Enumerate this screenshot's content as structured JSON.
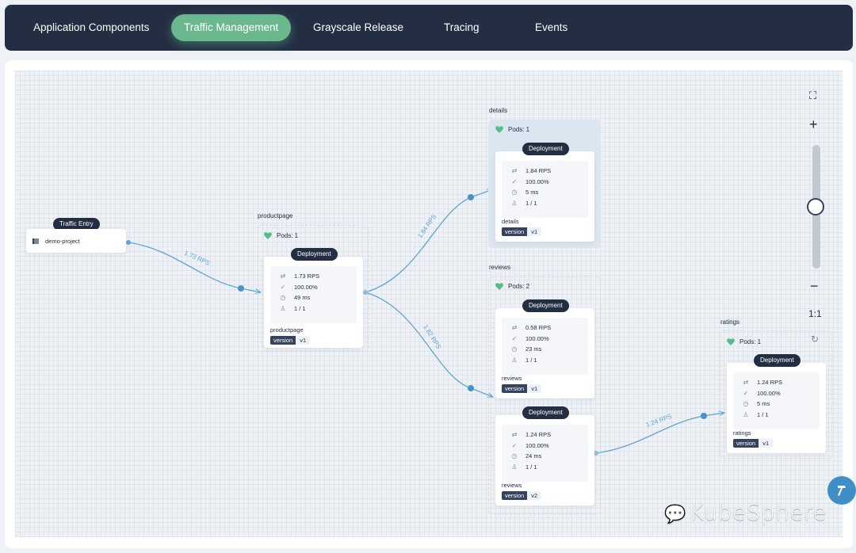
{
  "nav": {
    "tabs": [
      {
        "label": "Application Components",
        "active": false
      },
      {
        "label": "Traffic Management",
        "active": true
      },
      {
        "label": "Grayscale Release",
        "active": false
      },
      {
        "label": "Tracing",
        "active": false
      },
      {
        "label": "Events",
        "active": false
      }
    ]
  },
  "colors": {
    "nav_bg": "#242e42",
    "active_tab": "#6bb88e",
    "edge": "#5ea6d6",
    "healthy": "#55bc8a"
  },
  "traffic_entry": {
    "badge": "Traffic Entry",
    "project": "demo-project",
    "icon": "project-icon"
  },
  "edges": [
    {
      "from": "demo-project",
      "to": "productpage",
      "label": "1.73 RPS"
    },
    {
      "from": "productpage",
      "to": "details",
      "label": "1.84 RPS"
    },
    {
      "from": "productpage",
      "to": "reviews",
      "label": "1.82 RPS"
    },
    {
      "from": "reviews-v2",
      "to": "ratings",
      "label": "1.24 RPS"
    }
  ],
  "services": {
    "productpage": {
      "title": "productpage",
      "pods": "Pods: 1",
      "deployments": [
        {
          "badge": "Deployment",
          "rps": "1.73 RPS",
          "success": "100.00%",
          "latency": "49 ms",
          "replicas": "1 / 1",
          "name": "productpage",
          "label_key": "version",
          "label_value": "v1"
        }
      ]
    },
    "details": {
      "title": "details",
      "pods": "Pods: 1",
      "deployments": [
        {
          "badge": "Deployment",
          "rps": "1.84 RPS",
          "success": "100.00%",
          "latency": "5 ms",
          "replicas": "1 / 1",
          "name": "details",
          "label_key": "version",
          "label_value": "v1"
        }
      ]
    },
    "reviews": {
      "title": "reviews",
      "pods": "Pods: 2",
      "deployments": [
        {
          "badge": "Deployment",
          "rps": "0.58 RPS",
          "success": "100.00%",
          "latency": "23 ms",
          "replicas": "1 / 1",
          "name": "reviews",
          "label_key": "version",
          "label_value": "v1"
        },
        {
          "badge": "Deployment",
          "rps": "1.24 RPS",
          "success": "100.00%",
          "latency": "24 ms",
          "replicas": "1 / 1",
          "name": "reviews",
          "label_key": "version",
          "label_value": "v2"
        }
      ]
    },
    "ratings": {
      "title": "ratings",
      "pods": "Pods: 1",
      "deployments": [
        {
          "badge": "Deployment",
          "rps": "1.24 RPS",
          "success": "100.00%",
          "latency": "5 ms",
          "replicas": "1 / 1",
          "name": "ratings",
          "label_key": "version",
          "label_value": "v1"
        }
      ]
    }
  },
  "metric_icons": {
    "rps": "⇄",
    "success": "✓",
    "latency": "◷",
    "replicas": "♙"
  },
  "zoom_controls": {
    "fit": "⛶",
    "zoom_in": "+",
    "zoom_out": "−",
    "reset_ratio": "1:1",
    "refresh": "↻",
    "zoom_level": 0.5
  },
  "watermark": "KubeSphere"
}
